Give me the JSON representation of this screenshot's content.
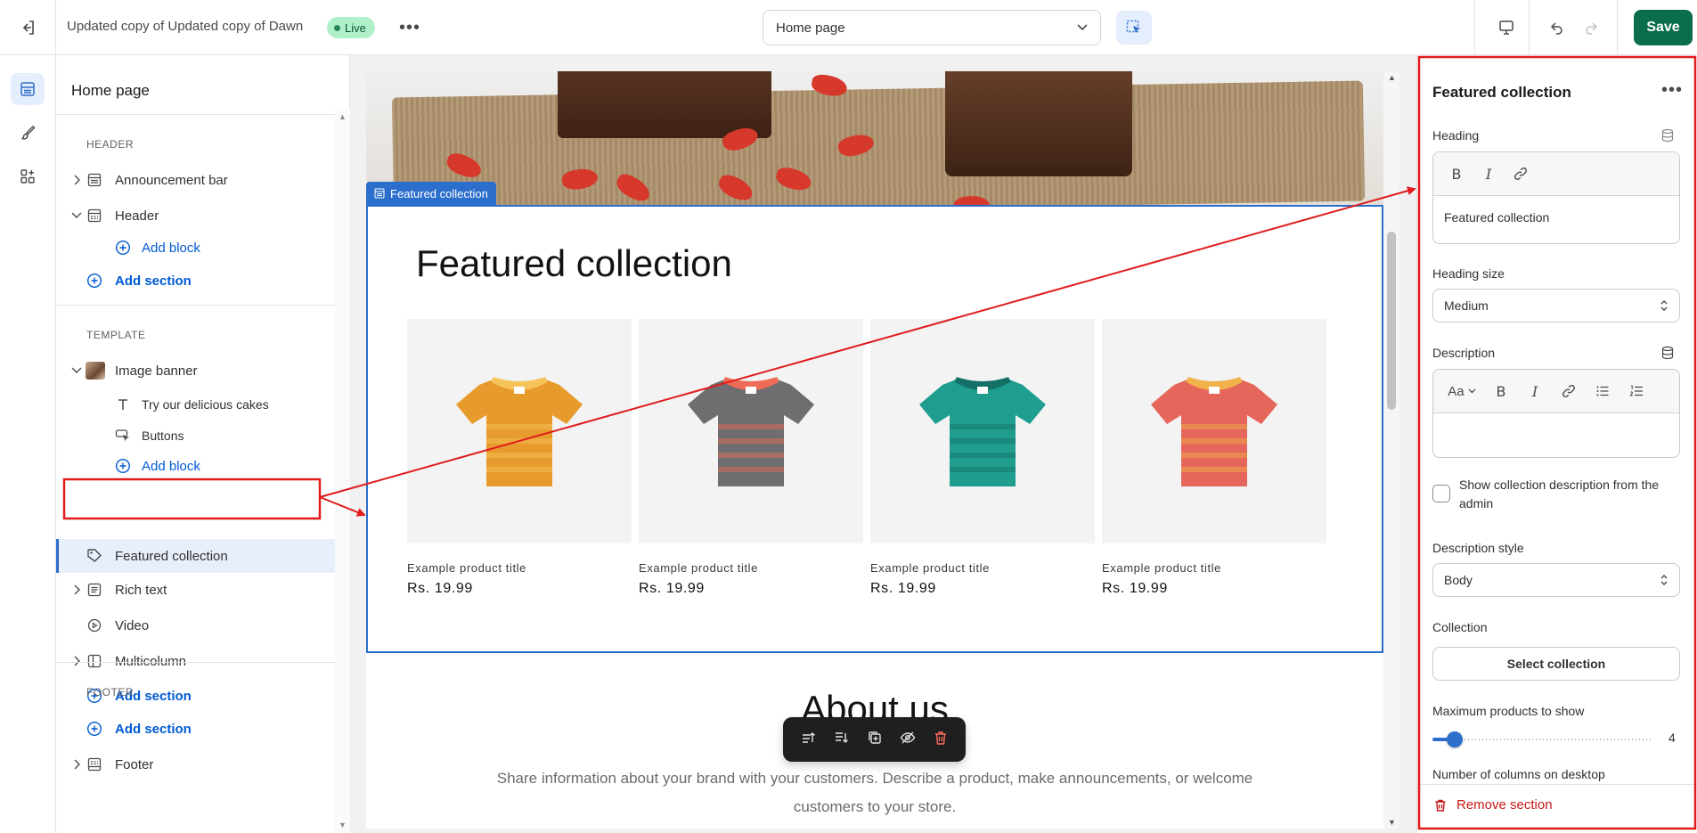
{
  "topbar": {
    "theme_name": "Updated copy of Updated copy of Dawn",
    "status_badge": "Live",
    "page_select": "Home page",
    "save_label": "Save"
  },
  "sidebar": {
    "title": "Home page",
    "header_group": "HEADER",
    "template_group": "TEMPLATE",
    "footer_group": "FOOTER",
    "items": {
      "announcement_bar": "Announcement bar",
      "header": "Header",
      "header_add_block": "Add block",
      "header_add_section": "Add section",
      "image_banner": "Image banner",
      "banner_text": "Try our delicious cakes",
      "banner_buttons": "Buttons",
      "banner_add_block": "Add block",
      "featured_collection": "Featured collection",
      "rich_text": "Rich text",
      "video": "Video",
      "multicolumn": "Multicolumn",
      "template_add_section": "Add section",
      "footer_add_section": "Add section",
      "footer": "Footer"
    }
  },
  "preview": {
    "section_tag": "Featured collection",
    "heading": "Featured collection",
    "products": [
      {
        "title": "Example product title",
        "price": "Rs. 19.99",
        "shirt": "#e79b2c",
        "accent": "#f6c35a"
      },
      {
        "title": "Example product title",
        "price": "Rs. 19.99",
        "shirt": "#6e6e70",
        "accent": "#ee6b55"
      },
      {
        "title": "Example product title",
        "price": "Rs. 19.99",
        "shirt": "#1f9d8f",
        "accent": "#137067"
      },
      {
        "title": "Example product title",
        "price": "Rs. 19.99",
        "shirt": "#e5665a",
        "accent": "#f2b24a"
      }
    ],
    "about_heading": "About us",
    "about_text": "Share information about your brand with your customers. Describe a product, make announcements, or welcome customers to your store."
  },
  "settings": {
    "title": "Featured collection",
    "heading_label": "Heading",
    "heading_value": "Featured collection",
    "heading_size_label": "Heading size",
    "heading_size_value": "Medium",
    "description_label": "Description",
    "description_font_btn": "Aa",
    "show_description_label": "Show collection description from the admin",
    "show_description_checked": false,
    "description_style_label": "Description style",
    "description_style_value": "Body",
    "collection_label": "Collection",
    "select_collection_label": "Select collection",
    "max_products_label": "Maximum products to show",
    "max_products_value": "4",
    "max_products_fraction": 0.1,
    "columns_label": "Number of columns on desktop",
    "remove_label": "Remove section"
  },
  "colors": {
    "accent": "#2c6ecb",
    "save": "#0a6e4a",
    "annotation": "#e11b1b",
    "danger": "#c71a1a"
  }
}
